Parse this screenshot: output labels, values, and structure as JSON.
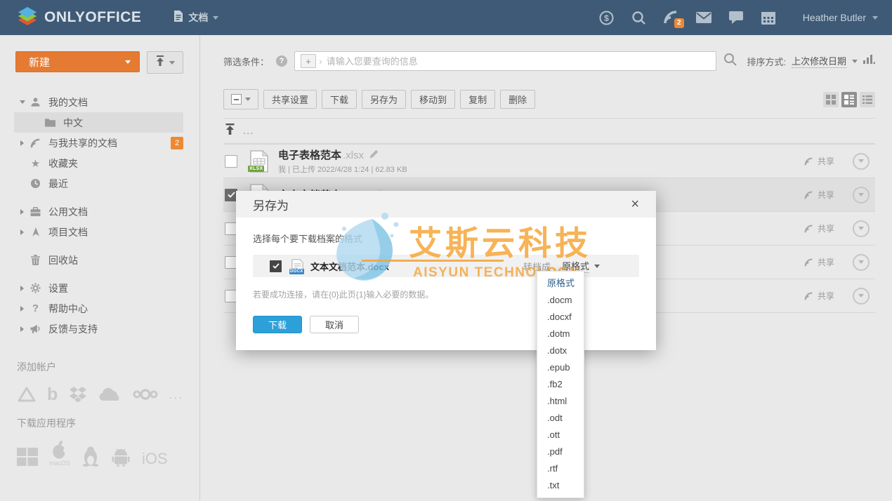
{
  "topbar": {
    "brand": "ONLYOFFICE",
    "nav_documents": "文档",
    "feed_badge": "2",
    "user_name": "Heather Butler"
  },
  "sidebar": {
    "new_button": "新建",
    "items": {
      "my_documents": "我的文档",
      "folder_zh": "中文",
      "shared": "与我共享的文档",
      "favorites": "收藏夹",
      "recent": "最近",
      "common": "公用文档",
      "projects": "项目文档",
      "trash": "回收站",
      "settings": "设置",
      "help": "帮助中心",
      "feedback": "反馈与支持"
    },
    "shared_badge": "2",
    "add_account": "添加帐户",
    "more_accounts": "...",
    "download_apps": "下载应用程序",
    "macos_label": "macOS",
    "ios_label": "iOS"
  },
  "filterbar": {
    "label": "筛选条件：",
    "placeholder": "请输入您要查询的信息",
    "sort_label": "排序方式:",
    "sort_value": "上次修改日期"
  },
  "toolbar": {
    "buttons": [
      "共享设置",
      "下载",
      "另存为",
      "移动到",
      "复制",
      "删除"
    ]
  },
  "file_list": {
    "up_more": "...",
    "share_label": "共享",
    "rows": [
      {
        "name": "电子表格范本",
        "ext": ".xlsx",
        "badge": "XLSX",
        "meta": "我 | 已上传 2022/4/28 1:24 | 62.83 KB"
      },
      {
        "name": "文本文档范本",
        "ext": ".docx",
        "badge": "DOCX"
      },
      {},
      {},
      {}
    ]
  },
  "dialog": {
    "title": "另存为",
    "subtitle": "选择每个要下载档案的格式",
    "file_name": "文本文档范本.docx",
    "file_badge": "DOCX",
    "convert_label": "转档成",
    "format_value": "原格式",
    "note": "若要成功连接，请在{0}此页{1}输入必要的数据。",
    "download_button": "下载",
    "cancel_button": "取消"
  },
  "format_menu": {
    "items": [
      "原格式",
      ".docm",
      ".docxf",
      ".dotm",
      ".dotx",
      ".epub",
      ".fb2",
      ".html",
      ".odt",
      ".ott",
      ".pdf",
      ".rtf",
      ".txt"
    ]
  },
  "watermark": {
    "title": "艾斯云科技",
    "subtitle": "AISYUN TECHNOLOGY"
  },
  "colors": {
    "topbar": "#3e5a76",
    "accent_orange": "#e57b33",
    "badge_orange": "#ee8932",
    "primary_blue": "#2da0d9",
    "watermark_orange": "#f5a232"
  }
}
